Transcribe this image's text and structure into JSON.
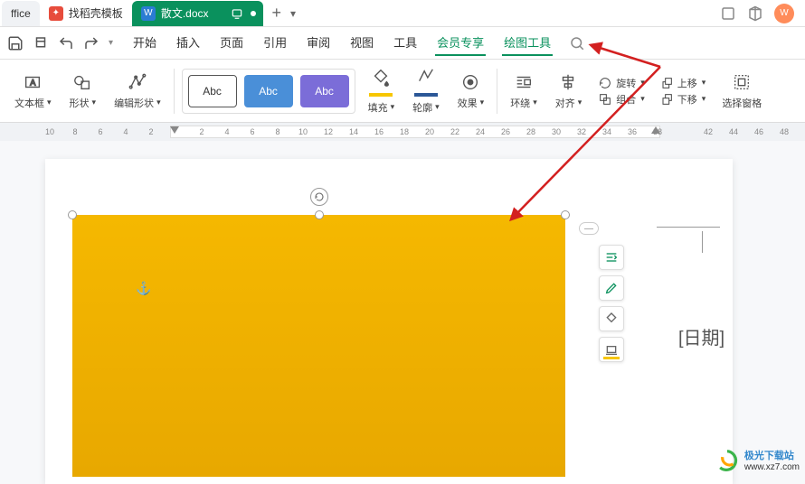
{
  "tabs": {
    "office": "ffice",
    "template": "找稻壳模板",
    "active": "散文.docx"
  },
  "menu": {
    "start": "开始",
    "insert": "插入",
    "page": "页面",
    "reference": "引用",
    "review": "审阅",
    "view": "视图",
    "tool": "工具",
    "vip": "会员专享",
    "drawing": "绘图工具"
  },
  "ribbon": {
    "textbox": "文本框",
    "shapes": "形状",
    "editshape": "编辑形状",
    "abc": "Abc",
    "fill": "填充",
    "outline": "轮廓",
    "effect": "效果",
    "wrap": "环绕",
    "align": "对齐",
    "rotate": "旋转",
    "group": "组合",
    "moveup": "上移",
    "movedown": "下移",
    "pane": "选择窗格"
  },
  "ruler_marks": [
    "10",
    "8",
    "6",
    "4",
    "2",
    "",
    "2",
    "4",
    "6",
    "8",
    "10",
    "12",
    "14",
    "16",
    "18",
    "20",
    "22",
    "24",
    "26",
    "28",
    "30",
    "32",
    "34",
    "36",
    "38",
    "",
    "42",
    "44",
    "46",
    "48"
  ],
  "date_placeholder": "[日期]",
  "watermark": {
    "name": "极光下载站",
    "url": "www.xz7.com"
  },
  "colors": {
    "primary": "#0a915d",
    "shape_fill": "#f5b800",
    "fill_swatch": "#f7c600",
    "outline_swatch": "#2b5797"
  }
}
